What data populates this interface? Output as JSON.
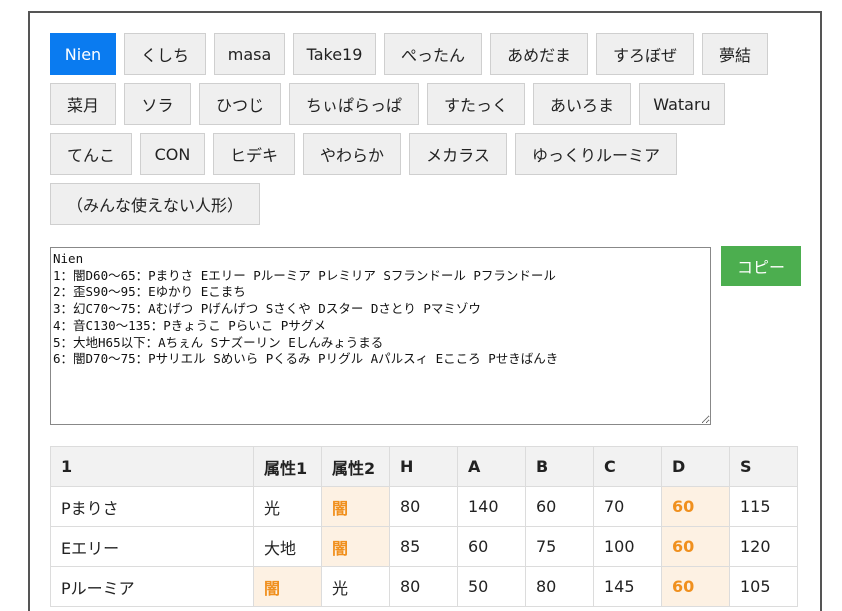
{
  "players": [
    {
      "label": "Nien",
      "active": true
    },
    {
      "label": "くしち"
    },
    {
      "label": "masa"
    },
    {
      "label": "Take19"
    },
    {
      "label": "ぺったん"
    },
    {
      "label": "あめだま"
    },
    {
      "label": "すろぼぜ"
    },
    {
      "label": "夢結"
    },
    {
      "label": "菜月"
    },
    {
      "label": "ソラ"
    },
    {
      "label": "ひつじ"
    },
    {
      "label": "ちぃぱらっぱ"
    },
    {
      "label": "すたっく"
    },
    {
      "label": "あいろま"
    },
    {
      "label": "Wataru"
    },
    {
      "label": "てんこ"
    },
    {
      "label": "CON"
    },
    {
      "label": "ヒデキ"
    },
    {
      "label": "やわらか"
    },
    {
      "label": "メカラス"
    },
    {
      "label": "ゆっくりルーミア"
    },
    {
      "label": "（みんな使えない人形）"
    }
  ],
  "textarea": {
    "value": "Nien\n1：闇D60～65：Pまりさ Eエリー Pルーミア Pレミリア Sフランドール Pフランドール\n2：歪S90～95：Eゆかり Eこまち\n3：幻C70～75：Aむげつ Pげんげつ Sさくや Dスター Dさとり Pマミゾウ\n4：音C130～135：Pきょうこ Pらいこ Pサグメ\n5：大地H65以下：Aちぇん Sナズーリン Eしんみょうまる\n6：闇D70～75：Pサリエル Sめいら Pくるみ Pリグル Aパルスィ Eこころ Pせきばんき"
  },
  "copy_button": {
    "label": "コピー"
  },
  "table": {
    "headers": [
      "1",
      "属性1",
      "属性2",
      "H",
      "A",
      "B",
      "C",
      "D",
      "S"
    ],
    "rows": [
      {
        "cells": [
          "Pまりさ",
          "光",
          "闇",
          "80",
          "140",
          "60",
          "70",
          "60",
          "115"
        ],
        "highlight": [
          2,
          7
        ]
      },
      {
        "cells": [
          "Eエリー",
          "大地",
          "闇",
          "85",
          "60",
          "75",
          "100",
          "60",
          "120"
        ],
        "highlight": [
          2,
          7
        ]
      },
      {
        "cells": [
          "Pルーミア",
          "闇",
          "光",
          "80",
          "50",
          "80",
          "145",
          "60",
          "105"
        ],
        "highlight": [
          1,
          7
        ]
      }
    ]
  }
}
